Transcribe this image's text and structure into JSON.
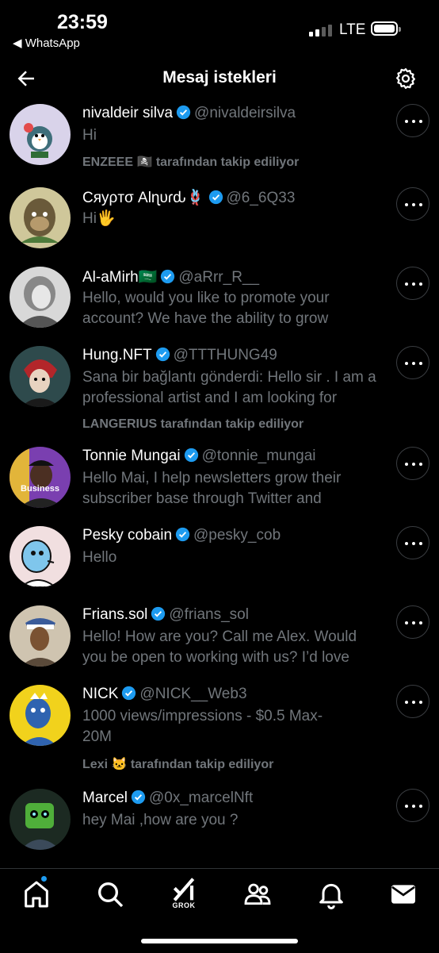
{
  "status_bar": {
    "time": "23:59",
    "back_app": "◀ WhatsApp",
    "network": "LTE"
  },
  "header": {
    "title": "Mesaj istekleri"
  },
  "requests": [
    {
      "name": "nivaldeir silva",
      "handle": "@nivaldeirsilva",
      "message": "Hi",
      "followed_by": "ENZEEE 🏴‍☠️ tarafından takip ediliyor"
    },
    {
      "name": "Cяуρтσ Alɳυɾԃ🪢",
      "handle": "@6_6Q33",
      "message": "Hi🖐",
      "followed_by": ""
    },
    {
      "name": "Al-aMirh🇸🇦",
      "handle": "@aRrr_R__",
      "message": "Hello, would you like to promote your account? We have the ability to grow",
      "followed_by": ""
    },
    {
      "name": "Hung.NFT",
      "handle": "@TTTHUNG49",
      "message": "Sana bir bağlantı gönderdi: Hello sir . I am a professional artist and I am looking for",
      "followed_by": "LANGERIUS tarafından takip ediliyor"
    },
    {
      "name": "Tonnie Mungai",
      "handle": "@tonnie_mungai",
      "message": "Hello Mai, I help newsletters grow their subscriber base through Twitter and",
      "followed_by": "",
      "avatar_label": "Business"
    },
    {
      "name": "Pesky cobain",
      "handle": "@pesky_cob",
      "message": "Hello",
      "followed_by": ""
    },
    {
      "name": "Frians.sol",
      "handle": "@frians_sol",
      "message": "Hello! How are you? Call me Alex. Would you be open to working with us? I’d love",
      "followed_by": ""
    },
    {
      "name": "NICK",
      "handle": "@NICK__Web3",
      "message": "1000 views/impressions - $0.5 Max-20M",
      "followed_by": "Lexi 🐱 tarafından takip ediliyor"
    },
    {
      "name": "Marcel",
      "handle": "@0x_marcelNft",
      "message": "hey Mai ,how are you ?",
      "followed_by": ""
    }
  ],
  "tabbar": {
    "grok_label": "GROK"
  },
  "colors": {
    "background": "#000000",
    "verified": "#1d9bf0",
    "secondary_text": "#71767b",
    "divider": "#2f3336"
  },
  "icons": [
    "back-arrow-icon",
    "settings-gear-icon",
    "verified-badge-icon",
    "more-options-icon",
    "home-icon",
    "search-icon",
    "grok-icon",
    "communities-icon",
    "notifications-icon",
    "messages-icon"
  ]
}
